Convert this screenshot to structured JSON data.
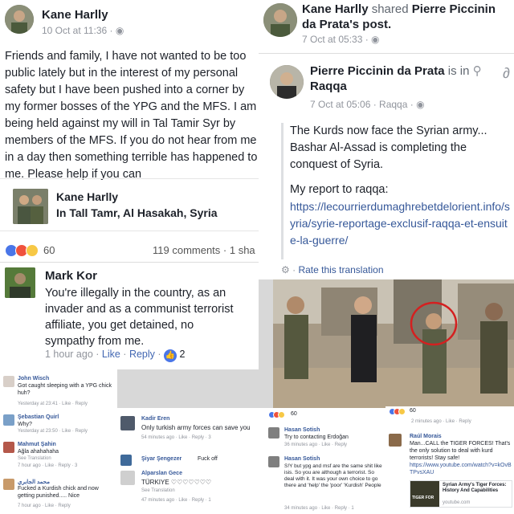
{
  "kane_post": {
    "author": "Kane Harlly",
    "time": "10 Oct at 11:36 · ",
    "body": "Friends and family, I have not wanted to be too public lately but in the interest of my personal safety but I have been pushed into a corner by my former bosses of the YPG and the MFS. I am being held against my will in Tal Tamir Syr by members of the MFS. If you do not hear from me in a day then something terrible has happened to me. Please help if you can",
    "location_name": "Kane Harlly",
    "location_place": "In Tall Tamr, Al Hasakah, Syria",
    "reaction_count": "60",
    "comments": "119 comments · 1 sha"
  },
  "mark_comment": {
    "author": "Mark Kor",
    "text": "You're illegally in the country, as an invader and as a communist terrorist affiliate, you get detained, no sympathy from me.",
    "time": "1 hour ago",
    "like": "Like",
    "reply": "Reply",
    "likes": "2"
  },
  "shared_post": {
    "sharer": "Kane Harlly",
    "shared_word": "shared",
    "page": "Pierre Piccinin da Prata",
    "suffix": "'s post.",
    "time": "7 Oct at 05:33 · "
  },
  "pierre_post": {
    "author": "Pierre Piccinin da Prata",
    "is_in": "is in",
    "place": "Raqqa",
    "time": "7 Oct at 05:06 · Raqqa · ",
    "line1": "The Kurds now face the Syrian army... Bashar Al-Assad is completing the conquest of Syria.",
    "line2": "My report to raqqa:",
    "url": "https://lecourrierdumaghrebetdelorient.info/syria/syrie-reportage-exclusif-raqqa-et-ensuite-la-guerre/",
    "rate": "Rate this translation"
  },
  "left_comments": [
    {
      "name": "John Wisch",
      "text": "Got caught sleeping with a YPG chick huh?",
      "meta": "Yesterday at 23:41 · Like · Reply"
    },
    {
      "name": "Şebastian Quirl",
      "text": "Why?",
      "meta": "Yesterday at 23:50 · Like · Reply"
    },
    {
      "name": "Mahmut Şahin",
      "text": "Ağla ahahahaha",
      "sub": "See Translation",
      "meta": "7 hour ago · Like · Reply · 3"
    },
    {
      "name": "محمد الجابري",
      "text": "Fucked a Kurdish chick and now getting punished..... Nice",
      "meta": "7 hour ago · Like · Reply"
    }
  ],
  "mid_comments": [
    {
      "name": "Kadir Eren",
      "text": "Only turkish army forces can save you",
      "meta": "54 minutes ago · Like · Reply · 3"
    },
    {
      "name": "Şiyar Şengezer",
      "text": "Fuck off",
      "meta": ""
    },
    {
      "name": "Alparslan Gece",
      "text": "TÜRKIYE ♡♡♡♡♡♡♡",
      "sub": "See Translation",
      "meta": "47 minutes ago · Like · Reply · 1"
    }
  ],
  "right_mid": {
    "count": "60",
    "comments": [
      {
        "name": "Hasan Sotish",
        "text": "Try to contacting Erdoğan",
        "meta": "36 minutes ago · Like · Reply"
      },
      {
        "name": "Hasan Sotish",
        "text": "S!Y but ypg and msf are the same shit like isis. So you are although a terrorist. So deal with it. It was your own choice to go there and 'help' the 'poor' 'Kurdish' People",
        "meta": "34 minutes ago · Like · Reply · 1"
      }
    ]
  },
  "right_far": {
    "count": "60",
    "top_meta": "2 minutes ago · Like · Reply",
    "name": "Raúl Morais",
    "text": "Man...CALL the TIGER FORCES! That's the only solution to deal with kurd terrorists! Stay safe!",
    "url": "https://www.youtube.com/watch?v=kOvBTPvsXAU",
    "card_title": "Syrian Army's Tiger Forces: History And Capabilities",
    "card_domain": "youtube.com",
    "card_thumb": "TIGER FOR"
  },
  "colors": {
    "link": "#365899",
    "like": "#4267b2",
    "meta": "#90949c"
  }
}
